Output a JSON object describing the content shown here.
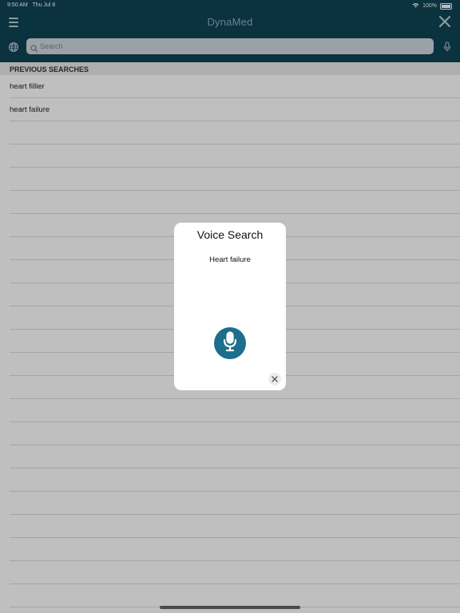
{
  "status": {
    "time": "9:50 AM",
    "date": "Thu Jul 8",
    "battery": "100%"
  },
  "header": {
    "title": "DynaMed",
    "menu_icon": "hamburger-icon",
    "close_icon": "close-icon"
  },
  "search": {
    "placeholder": "Search",
    "language_icon": "globe-icon",
    "mic_icon": "microphone-icon"
  },
  "list": {
    "header": "PREVIOUS SEARCHES",
    "items": [
      "heart fillier",
      "heart failure"
    ]
  },
  "modal": {
    "title": "Voice Search",
    "transcript": "Heart failure",
    "mic_icon": "microphone-icon",
    "close_icon": "close-icon"
  },
  "colors": {
    "header_bg": "#0e4354",
    "mic_button": "#1b6e8c",
    "overlay": "rgba(0,0,0,0.25)"
  }
}
